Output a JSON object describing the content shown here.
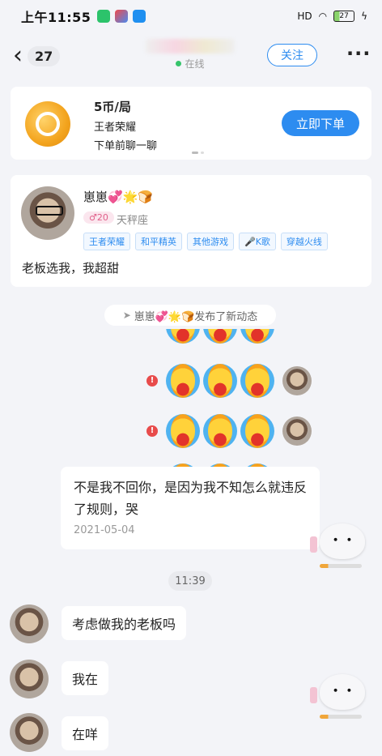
{
  "status_bar": {
    "time": "上午11:55",
    "signal": "HD",
    "battery": "27"
  },
  "header": {
    "unread_count": "27",
    "online_status": "在线",
    "follow_label": "关注"
  },
  "order_card": {
    "price": "5币/局",
    "game": "王者荣耀",
    "note": "下单前聊一聊",
    "order_button": "立即下单"
  },
  "profile": {
    "name": "崽崽💞🌟🍞",
    "level": "♂20",
    "zodiac": "天秤座",
    "tags": [
      "王者荣耀",
      "和平精英",
      "其他游戏",
      "🎤K歌",
      "穿越火线"
    ],
    "bio": "老板选我，我超甜"
  },
  "system_notice": "崽崽💞🌟🍞发布了新动态",
  "messages": {
    "long_text": "不是我不回你，是因为我不知怎么就违反了规则，哭",
    "long_date": "2021-05-04",
    "time_divider": "11:39",
    "msg1": "考虑做我的老板吗",
    "msg2": "我在",
    "msg3": "在咩"
  },
  "icons": {
    "back": "chevron-left-icon",
    "more": "more-dots-icon",
    "error": "error-icon",
    "send": "paper-plane-icon"
  },
  "colors": {
    "accent": "#2d8cf0",
    "online": "#36c46b",
    "error": "#e84b4b",
    "level_pink": "#e0608a"
  }
}
